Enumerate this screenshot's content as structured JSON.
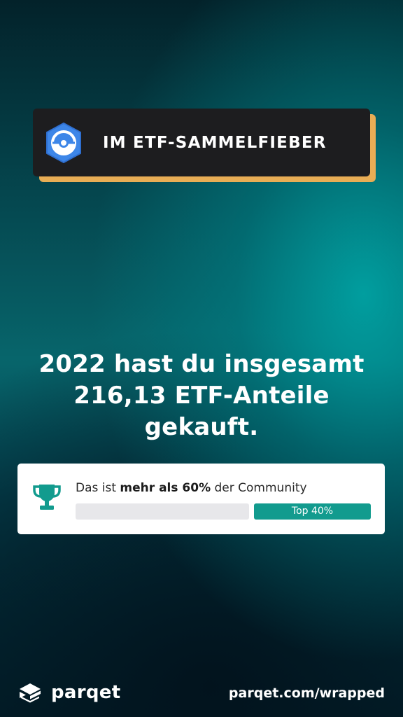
{
  "badge": {
    "icon": "pokeball-hexagon-icon",
    "title": "IM ETF-SAMMELFIEBER",
    "accent_color": "#e8ad55",
    "icon_color": "#3d86e8"
  },
  "headline": {
    "line1": "2022 hast du insgesamt",
    "line2": "216,13 ETF-Anteile",
    "line3": "gekauft."
  },
  "community": {
    "icon": "trophy-icon",
    "text_prefix": "Das ist ",
    "text_bold": "mehr als 60%",
    "text_suffix": " der Community",
    "rank_label": "Top 40%",
    "rank_fraction": 0.4,
    "accent_color": "#129b8e"
  },
  "footer": {
    "logo_icon": "parqet-logo-icon",
    "brand": "parqet",
    "url": "parqet.com/wrapped"
  }
}
